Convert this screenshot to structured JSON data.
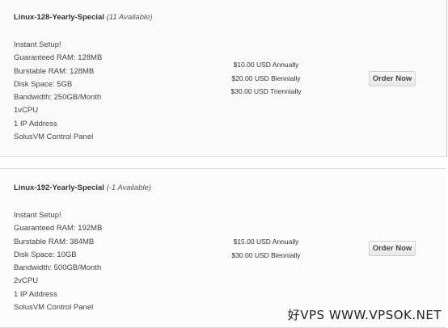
{
  "products": [
    {
      "name": "Linux-128-Yearly-Special",
      "availability": "(11 Available)",
      "features": [
        "Instant Setup!",
        "Guaranteed RAM: 128MB",
        "Burstable RAM: 128MB",
        "Disk Space: 5GB",
        "Bandwidth: 250GB/Month",
        "1vCPU",
        "1 IP Address",
        "SolusVM Control Panel"
      ],
      "pricing": [
        "$10.00 USD Annually",
        "$20.00 USD Biennially",
        "$30.00 USD Triennially"
      ],
      "order_label": "Order Now"
    },
    {
      "name": "Linux-192-Yearly-Special",
      "availability": "(-1 Available)",
      "features": [
        "Instant Setup!",
        "Guaranteed RAM: 192MB",
        "Burstable RAM: 384MB",
        "Disk Space: 10GB",
        "Bandwidth: 500GB/Month",
        "2vCPU",
        "1 IP Address",
        "SolusVM Control Panel"
      ],
      "pricing": [
        "$15.00 USD Annually",
        "$30.00 USD Biennially"
      ],
      "order_label": "Order Now"
    }
  ],
  "watermark": "好VPS WWW.VPSOK.NET"
}
